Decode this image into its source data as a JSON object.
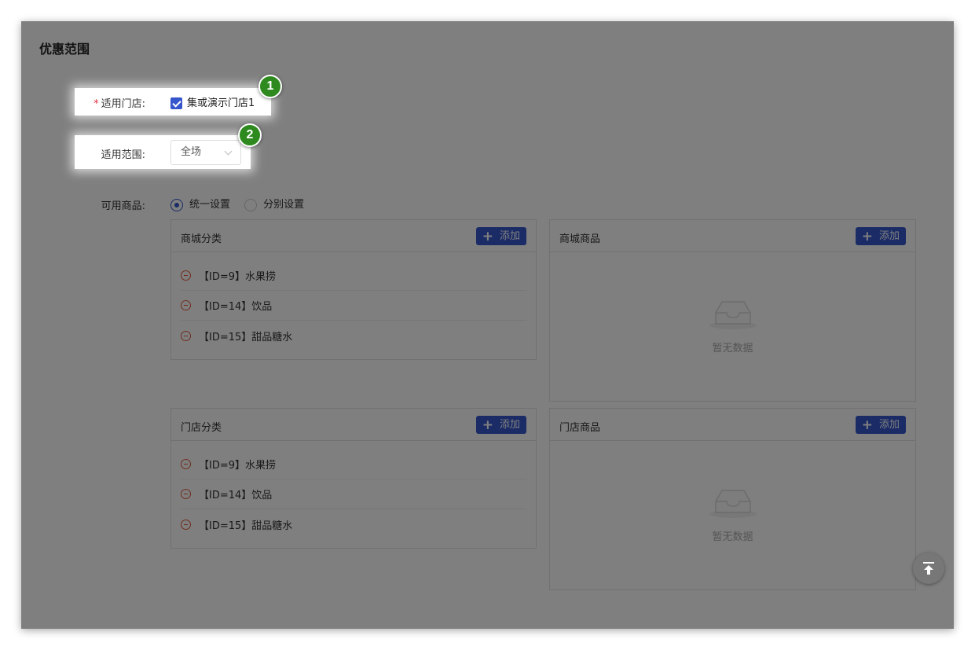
{
  "section_title": "优惠范围",
  "store": {
    "required_mark": "*",
    "label": "适用门店:",
    "checkbox_label": "集或演示门店1",
    "checked": true
  },
  "scope": {
    "label": "适用范围:",
    "value": "全场"
  },
  "products": {
    "label": "可用商品:",
    "options": [
      {
        "label": "统一设置",
        "selected": true
      },
      {
        "label": "分别设置",
        "selected": false
      }
    ]
  },
  "badges": [
    "1",
    "2"
  ],
  "boxes": {
    "mall_category": {
      "title": "商城分类",
      "add_label": "添加",
      "items": [
        "【ID=9】水果捞",
        "【ID=14】饮品",
        "【ID=15】甜品糖水"
      ]
    },
    "mall_goods": {
      "title": "商城商品",
      "add_label": "添加",
      "empty_text": "暂无数据"
    },
    "store_category": {
      "title": "门店分类",
      "add_label": "添加",
      "items": [
        "【ID=9】水果捞",
        "【ID=14】饮品",
        "【ID=15】甜品糖水"
      ]
    },
    "store_goods": {
      "title": "门店商品",
      "add_label": "添加",
      "empty_text": "暂无数据"
    }
  },
  "icons": {
    "add": "plus-icon",
    "remove": "minus-circle-icon",
    "empty": "inbox-icon",
    "back_top": "arrow-up-to-top-icon",
    "check": "check-icon",
    "dropdown": "chevron-down-icon"
  },
  "colors": {
    "primary": "#3556cc",
    "required": "#e0303a",
    "remove": "#e05a3a",
    "badge": "#2e8a1e"
  }
}
